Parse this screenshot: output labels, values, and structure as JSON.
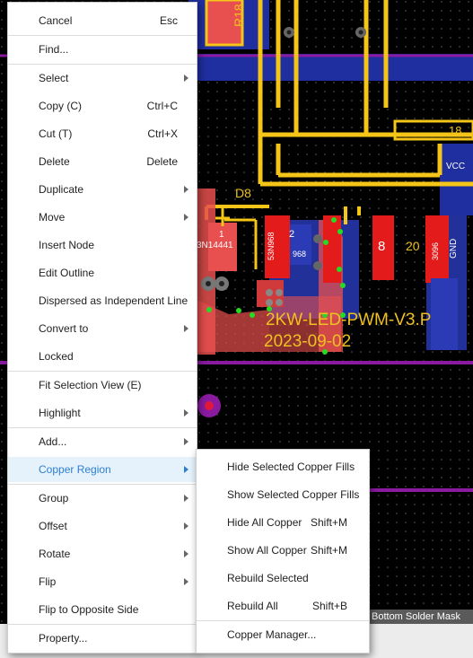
{
  "main_menu": {
    "items": [
      {
        "label": "Cancel",
        "shortcut": "Esc"
      },
      {
        "label": "Find..."
      },
      {
        "label": "Select",
        "has_submenu": true
      },
      {
        "label": "Copy (C)",
        "shortcut": "Ctrl+C"
      },
      {
        "label": "Cut (T)",
        "shortcut": "Ctrl+X"
      },
      {
        "label": "Delete",
        "shortcut": "Delete"
      },
      {
        "label": "Duplicate",
        "has_submenu": true
      },
      {
        "label": "Move",
        "has_submenu": true
      },
      {
        "label": "Insert Node"
      },
      {
        "label": "Edit Outline"
      },
      {
        "label": "Dispersed as Independent Line"
      },
      {
        "label": "Convert to",
        "has_submenu": true
      },
      {
        "label": "Locked"
      },
      {
        "label": "Fit Selection View (E)"
      },
      {
        "label": "Highlight",
        "has_submenu": true
      },
      {
        "label": "Add...",
        "has_submenu": true
      },
      {
        "label": "Copper Region",
        "has_submenu": true,
        "highlighted": true
      },
      {
        "label": "Group",
        "has_submenu": true
      },
      {
        "label": "Offset",
        "has_submenu": true
      },
      {
        "label": "Rotate",
        "has_submenu": true
      },
      {
        "label": "Flip",
        "has_submenu": true
      },
      {
        "label": "Flip to Opposite Side"
      },
      {
        "label": "Property..."
      }
    ]
  },
  "copper_region_submenu": {
    "items": [
      {
        "label": "Hide Selected Copper Fills"
      },
      {
        "label": "Show Selected Copper Fills"
      },
      {
        "label": "Hide All Copper",
        "shortcut": "Shift+M"
      },
      {
        "label": "Show All Copper",
        "shortcut": "Shift+M"
      },
      {
        "label": "Rebuild Selected"
      },
      {
        "label": "Rebuild All",
        "shortcut": "Shift+B"
      },
      {
        "label": "Copper Manager..."
      }
    ]
  },
  "pcb": {
    "silkscreen_lines": [
      "2KW-LED-PWM-V3.P",
      "2023-09-02"
    ],
    "designators": [
      "R18",
      "D8",
      "1",
      "2",
      "3N14441",
      "53N968",
      "968",
      "8",
      "20",
      "VCC",
      "18",
      "GND",
      "3096"
    ]
  },
  "status_bar": {
    "layer": "Bottom Solder Mask"
  },
  "colors": {
    "board_background": "#000000",
    "copper_fill": "#e8504f",
    "track_top": "#f5c518",
    "bottom_layer": "#2b3bb5",
    "board_outline": "#8a1aa0",
    "silkscreen": "#f0c020",
    "selection_vertex": "#22dd22",
    "menu_highlight_bg": "#e5f1fb",
    "menu_highlight_text": "#2d7fd3"
  }
}
